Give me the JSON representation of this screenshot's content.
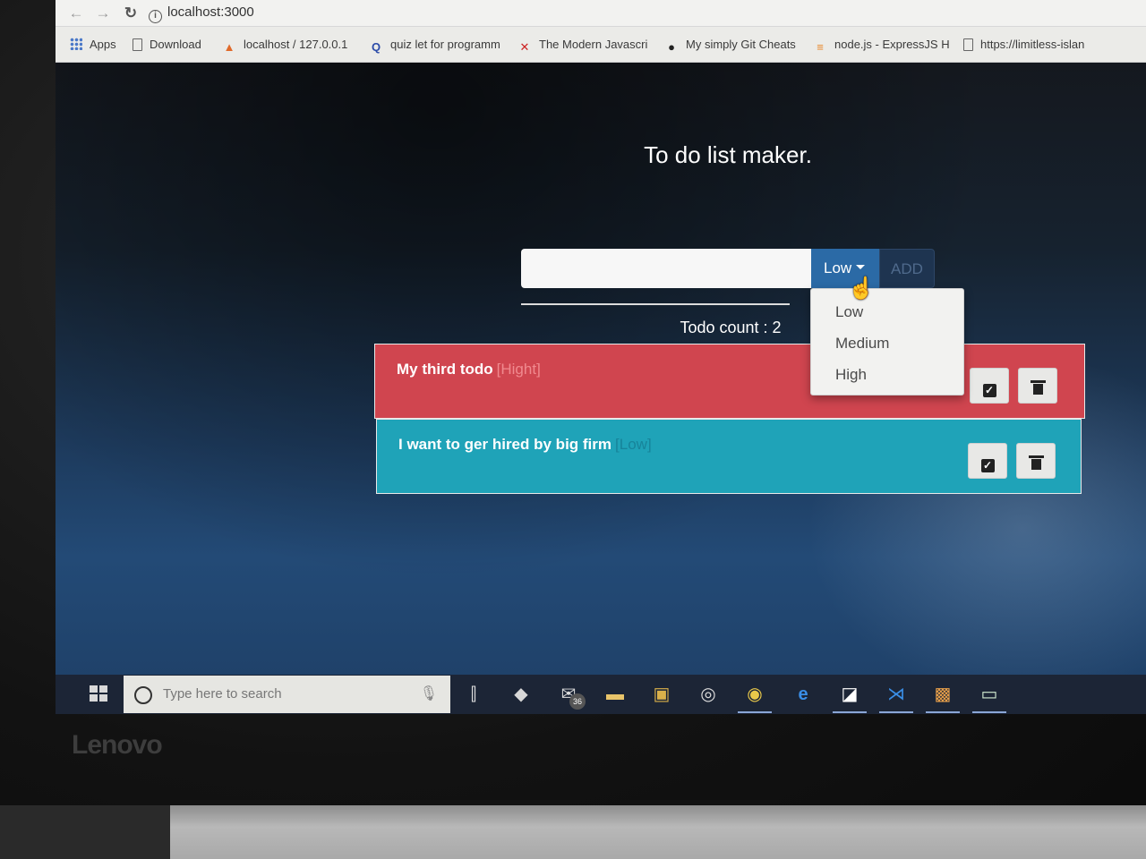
{
  "browser": {
    "url": "localhost:3000",
    "bookmarks": [
      {
        "label": "Apps",
        "icon": "apps-grid-icon"
      },
      {
        "label": "Download",
        "icon": "page-icon"
      },
      {
        "label": "localhost / 127.0.0.1",
        "icon": "phpmyadmin-icon"
      },
      {
        "label": "quiz let for programm",
        "icon": "quizlet-icon"
      },
      {
        "label": "The Modern Javascri",
        "icon": "javascript-icon"
      },
      {
        "label": "My simply Git Cheats",
        "icon": "github-icon"
      },
      {
        "label": "node.js - ExpressJS H",
        "icon": "stackoverflow-icon"
      },
      {
        "label": "https://limitless-islan",
        "icon": "page-icon"
      }
    ]
  },
  "app": {
    "title": "To do list maker.",
    "input_value": "",
    "priority_selected": "Low",
    "add_label": "ADD",
    "priority_options": [
      "Low",
      "Medium",
      "High"
    ],
    "count_text": "Todo count : 2",
    "todos": [
      {
        "text": "My third todo",
        "priority_label": "[Hight]",
        "color": "#d0454f"
      },
      {
        "text": "I want to ger hired by big firm",
        "priority_label": "[Low]",
        "color": "#1fa3b8"
      }
    ]
  },
  "taskbar": {
    "search_placeholder": "Type here to search",
    "mail_badge": "36",
    "icons": [
      "task-view-icon",
      "git-icon",
      "mail-icon",
      "file-explorer-icon",
      "store-icon",
      "settings-icon",
      "chrome-icon",
      "edge-icon",
      "sticky-notes-icon",
      "vscode-icon",
      "xampp-icon",
      "app-icon"
    ]
  },
  "device": {
    "brand": "Lenovo"
  }
}
